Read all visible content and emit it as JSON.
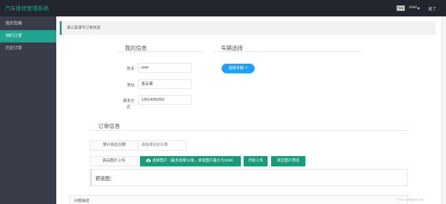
{
  "header": {
    "app_title": "汽车维修管理系统",
    "avatar_text": "Pers",
    "user_name": "user",
    "logout": "退了"
  },
  "sidebar": {
    "items": [
      {
        "label": "我的车辆",
        "active": false
      },
      {
        "label": "预约订单",
        "active": true
      },
      {
        "label": "历史订单",
        "active": false
      }
    ]
  },
  "notice": "请认真填写订单信息",
  "my_info": {
    "title": "我的信息",
    "fields": [
      {
        "label": "姓名",
        "value": "user"
      },
      {
        "label": "地址",
        "value": "连云港"
      },
      {
        "label_line1": "联系方",
        "label_line2": "式",
        "value": "13514250262"
      }
    ]
  },
  "vehicle": {
    "title": "车辆选择",
    "select_button": "选择车辆",
    "plus": "+"
  },
  "order": {
    "title": "订单信息",
    "date_label": "预计到达日期",
    "date_placeholder": "请选择到达日期",
    "upload_label": "商品图片上传",
    "select_images": "选择图片（最多选择10张，单张图片最大为10M）",
    "start_upload": "开始上传",
    "clear_preview": "清空图片预览",
    "preview_label": "预览图：",
    "problem_label": "问题描述"
  },
  "watermark": "CSDN @那波的行58K",
  "colors": {
    "accent": "#1fa58f",
    "sidebar": "#393d49",
    "topbar": "#23262e",
    "blue_button": "#1e9fff"
  }
}
